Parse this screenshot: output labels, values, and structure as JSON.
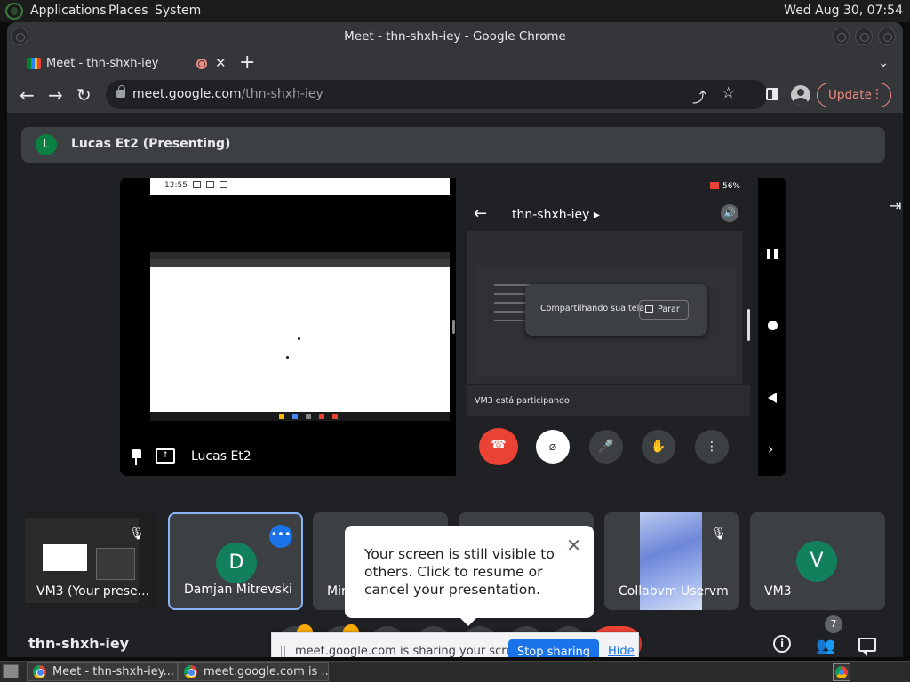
{
  "top_panel": {
    "menus": [
      "Applications",
      "Places",
      "System"
    ],
    "clock": "Wed Aug 30, 07:54"
  },
  "window": {
    "title": "Meet - thn-shxh-iey - Google Chrome"
  },
  "tab": {
    "label": "Meet - thn-shxh-iey",
    "close": "✕",
    "new_tab": "+",
    "search": "⌄"
  },
  "toolbar": {
    "back": "←",
    "forward": "→",
    "reload": "↻",
    "url_host": "meet.google.com",
    "url_path": "/thn-shxh-iey",
    "share": "⤴",
    "star": "☆",
    "update_label": "Update",
    "menu": "⋮"
  },
  "meet": {
    "presenting_avatar": "L",
    "presenting_banner": "Lucas Et2 (Presenting)",
    "stage_name": "Lucas Et2",
    "phone": {
      "status": "56%",
      "title": "thn-shxh-iey ▸",
      "volume": "🔊",
      "share_text": "Compartilhando sua tela",
      "stop_label": "Parar",
      "join_text": "VM3 está participando",
      "end_call": "☎",
      "camera": "⌀",
      "mic": "🎤",
      "hand": "✋",
      "more": "⋮"
    },
    "tiles": [
      {
        "name": "VM3 (Your prese...",
        "mic_off": "🎙"
      },
      {
        "name": "Damjan Mitrevski",
        "avatar": "D",
        "avatar_color": "#12805c",
        "more": "•••"
      },
      {
        "name": "Mir"
      },
      {
        "name": ""
      },
      {
        "name": "Collabvm Uservm",
        "mic_off": "🎙"
      },
      {
        "name": "VM3",
        "avatar": "V",
        "avatar_color": "#12805c"
      }
    ],
    "tooltip": {
      "message": "Your screen is still visible to others. Click to resume or cancel your presentation.",
      "close": "✕"
    },
    "meeting_code": "thn-shxh-iey",
    "info": "i",
    "people_count": "7",
    "people": "👥",
    "sharebar": {
      "message": "meet.google.com is sharing your screen.",
      "stop_label": "Stop sharing",
      "hide_label": "Hide"
    }
  },
  "taskbar": {
    "items": [
      "Meet - thn-shxh-iey...",
      "meet.google.com is ..."
    ]
  },
  "colors": {
    "accent_blue": "#1a73e8",
    "meet_bg": "#202124",
    "end_red": "#ea4335",
    "avatar_green": "#0b8043"
  }
}
